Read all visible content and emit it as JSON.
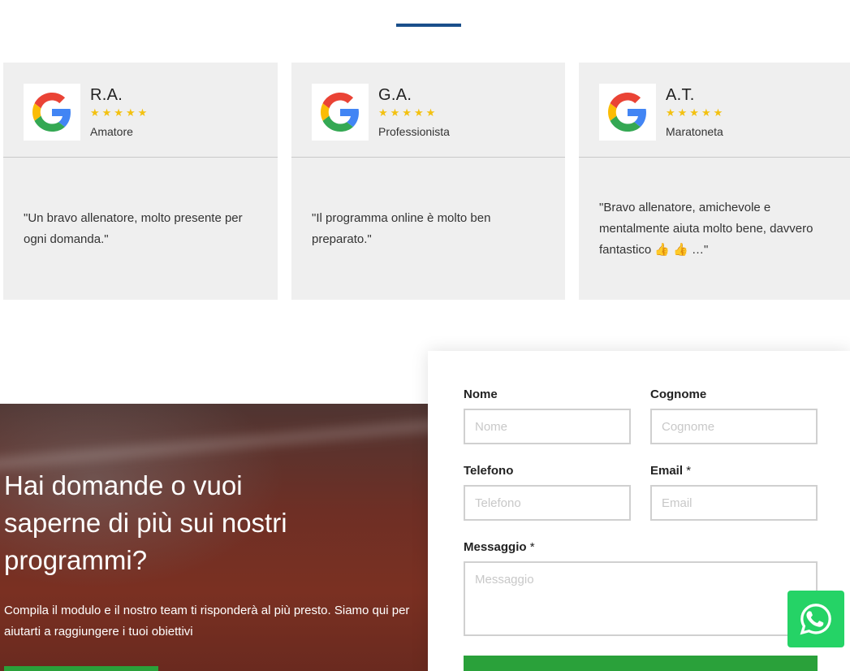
{
  "colors": {
    "accent_blue": "#1a4f8b",
    "star_yellow": "#f3c111",
    "card_bg": "#efefef",
    "button_green": "#2aa13a",
    "whatsapp_green": "#25d366"
  },
  "reviews": [
    {
      "name": "R.A.",
      "stars": "★★★★★",
      "role": "Amatore",
      "text": "\"Un bravo allenatore, molto presente per ogni domanda.\"",
      "icon": "google-logo"
    },
    {
      "name": "G.A.",
      "stars": "★★★★★",
      "role": "Professionista",
      "text": "\"Il programma online è molto ben preparato.\"",
      "icon": "google-logo"
    },
    {
      "name": "A.T.",
      "stars": "★★★★★",
      "role": "Maratoneta",
      "text": "\"Bravo allenatore, amichevole e mentalmente aiuta molto bene, davvero fantastico 👍 👍 …\"",
      "icon": "google-logo"
    }
  ],
  "hero": {
    "title": "Hai domande o vuoi saperne di più sui nostri programmi?",
    "subtitle": "Compila il modulo e il nostro team ti risponderà al più presto. Siamo qui per aiutarti a raggiungere i tuoi obiettivi"
  },
  "form": {
    "nome_label": "Nome",
    "nome_placeholder": "Nome",
    "cognome_label": "Cognome",
    "cognome_placeholder": "Cognome",
    "telefono_label": "Telefono",
    "telefono_placeholder": "Telefono",
    "email_label": "Email",
    "email_placeholder": "Email",
    "messaggio_label": "Messaggio",
    "messaggio_placeholder": "Messaggio",
    "required_mark": "*"
  },
  "whatsapp_icon": "whatsapp-icon"
}
